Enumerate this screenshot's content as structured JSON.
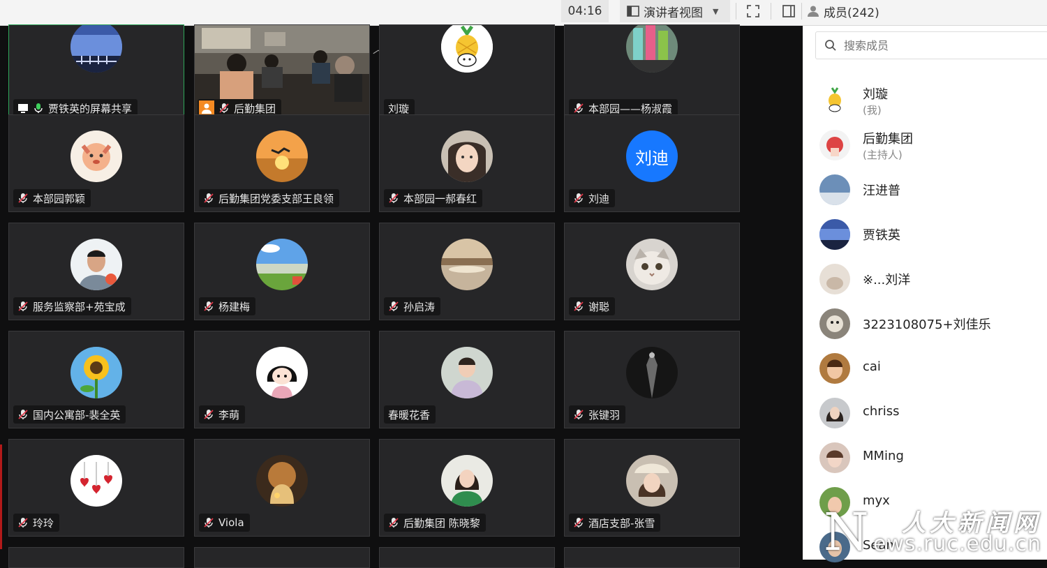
{
  "toolbar": {
    "timer": "04:16",
    "view_label": "演讲者视图",
    "members_label": "成员(242)"
  },
  "tiles": [
    {
      "name": "贾铁英的屏幕共享",
      "avatar": "landscape-night-sky"
    },
    {
      "name": "后勤集团",
      "avatar": "meeting-room-camera"
    },
    {
      "name": "刘璇",
      "avatar": "pineapple-cartoon"
    },
    {
      "name": "本部园——杨淑霞",
      "avatar": "colorful-toys"
    },
    {
      "name": "本部园郭颖",
      "avatar": "red-panda-cartoon"
    },
    {
      "name": "后勤集团党委支部王良领",
      "avatar": "sunset-bird"
    },
    {
      "name": "本部园一郝春红",
      "avatar": "woman-portrait"
    },
    {
      "name": "刘迪",
      "avatar_text": "刘迪"
    },
    {
      "name": "服务监察部+苑宝成",
      "avatar": "man-portrait"
    },
    {
      "name": "杨建梅",
      "avatar": "garden-sky"
    },
    {
      "name": "孙启涛",
      "avatar": "sunset-lake"
    },
    {
      "name": "谢聪",
      "avatar": "cat"
    },
    {
      "name": "国内公寓部-裴全英",
      "avatar": "sunflower"
    },
    {
      "name": "李萌",
      "avatar": "cartoon-girl"
    },
    {
      "name": "春暖花香",
      "avatar": "girl-outdoor"
    },
    {
      "name": "张键羽",
      "avatar": "dark-figure"
    },
    {
      "name": "玲玲",
      "avatar": "hearts"
    },
    {
      "name": "Viola",
      "avatar": "warm-illustration"
    },
    {
      "name": "后勤集团 陈晓黎",
      "avatar": "girl-green"
    },
    {
      "name": "酒店支部-张雪",
      "avatar": "girl-hat"
    }
  ],
  "sidebar": {
    "search_placeholder": "搜索成员",
    "members": [
      {
        "name": "刘璇",
        "role": "(我)"
      },
      {
        "name": "后勤集团",
        "role": "(主持人)"
      },
      {
        "name": "汪进普"
      },
      {
        "name": "贾铁英"
      },
      {
        "name": "※...刘洋"
      },
      {
        "name": "3223108075+刘佳乐"
      },
      {
        "name": "cai"
      },
      {
        "name": "chriss"
      },
      {
        "name": "MMing"
      },
      {
        "name": "myx"
      },
      {
        "name": "Sean"
      }
    ]
  },
  "watermark": {
    "line1": "人大新闻网",
    "line2": "ews.ruc.edu.cn",
    "initial": "N"
  }
}
